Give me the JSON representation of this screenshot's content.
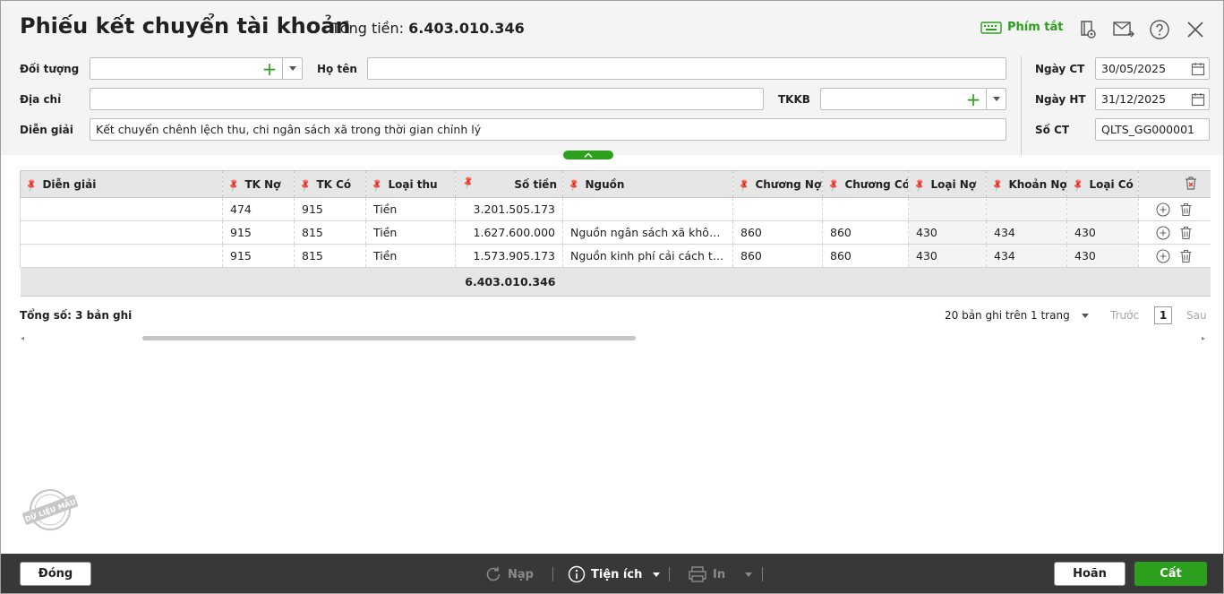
{
  "header": {
    "title": "Phiếu kết chuyển tài khoản",
    "total_label": "Tổng tiền:",
    "total_value": "6.403.010.346",
    "shortcut_label": "Phím tắt"
  },
  "form": {
    "doi_tuong_label": "Đối tượng",
    "doi_tuong_value": "",
    "ho_ten_label": "Họ tên",
    "ho_ten_value": "",
    "dia_chi_label": "Địa chỉ",
    "dia_chi_value": "",
    "tkkb_label": "TKKB",
    "tkkb_value": "",
    "dien_giai_label": "Diễn giải",
    "dien_giai_value": "Kết chuyển chênh lệch thu, chi ngân sách xã trong thời gian chỉnh lý",
    "ngay_ct_label": "Ngày CT",
    "ngay_ct_value": "30/05/2025",
    "ngay_ht_label": "Ngày HT",
    "ngay_ht_value": "31/12/2025",
    "so_ct_label": "Số CT",
    "so_ct_value": "QLTS_GG000001"
  },
  "table": {
    "columns": [
      "Diễn giải",
      "TK Nợ",
      "TK Có",
      "Loại thu",
      "Số tiền",
      "Nguồn",
      "Chương Nợ",
      "Chương Có",
      "Loại Nợ",
      "Khoản Nợ",
      "Loại Có"
    ],
    "rows": [
      [
        "",
        "474",
        "915",
        "Tiền",
        "3.201.505.173",
        "",
        "",
        "",
        "",
        "",
        ""
      ],
      [
        "",
        "915",
        "815",
        "Tiền",
        "1.627.600.000",
        "Nguồn ngân sách xã không tự chủ",
        "860",
        "860",
        "430",
        "434",
        "430"
      ],
      [
        "",
        "915",
        "815",
        "Tiền",
        "1.573.905.173",
        "Nguồn kinh phí cải cách tiền lương",
        "860",
        "860",
        "430",
        "434",
        "430"
      ]
    ],
    "footer_total": "6.403.010.346"
  },
  "summary": {
    "count_label": "Tổng số: 3 bản ghi",
    "page_size_label": "20 bản ghi trên 1 trang",
    "prev_label": "Trước",
    "page_number": "1",
    "next_label": "Sau"
  },
  "watermark": "DỮ LIỆU MẪU",
  "bottom": {
    "close_label": "Đóng",
    "reload_label": "Nạp",
    "utility_label": "Tiện ích",
    "print_label": "In",
    "cancel_label": "Hoãn",
    "save_label": "Cất"
  },
  "colors": {
    "accent": "#2ca01c",
    "bottom_bar": "#383838",
    "header_bg": "#f4f4f4"
  }
}
